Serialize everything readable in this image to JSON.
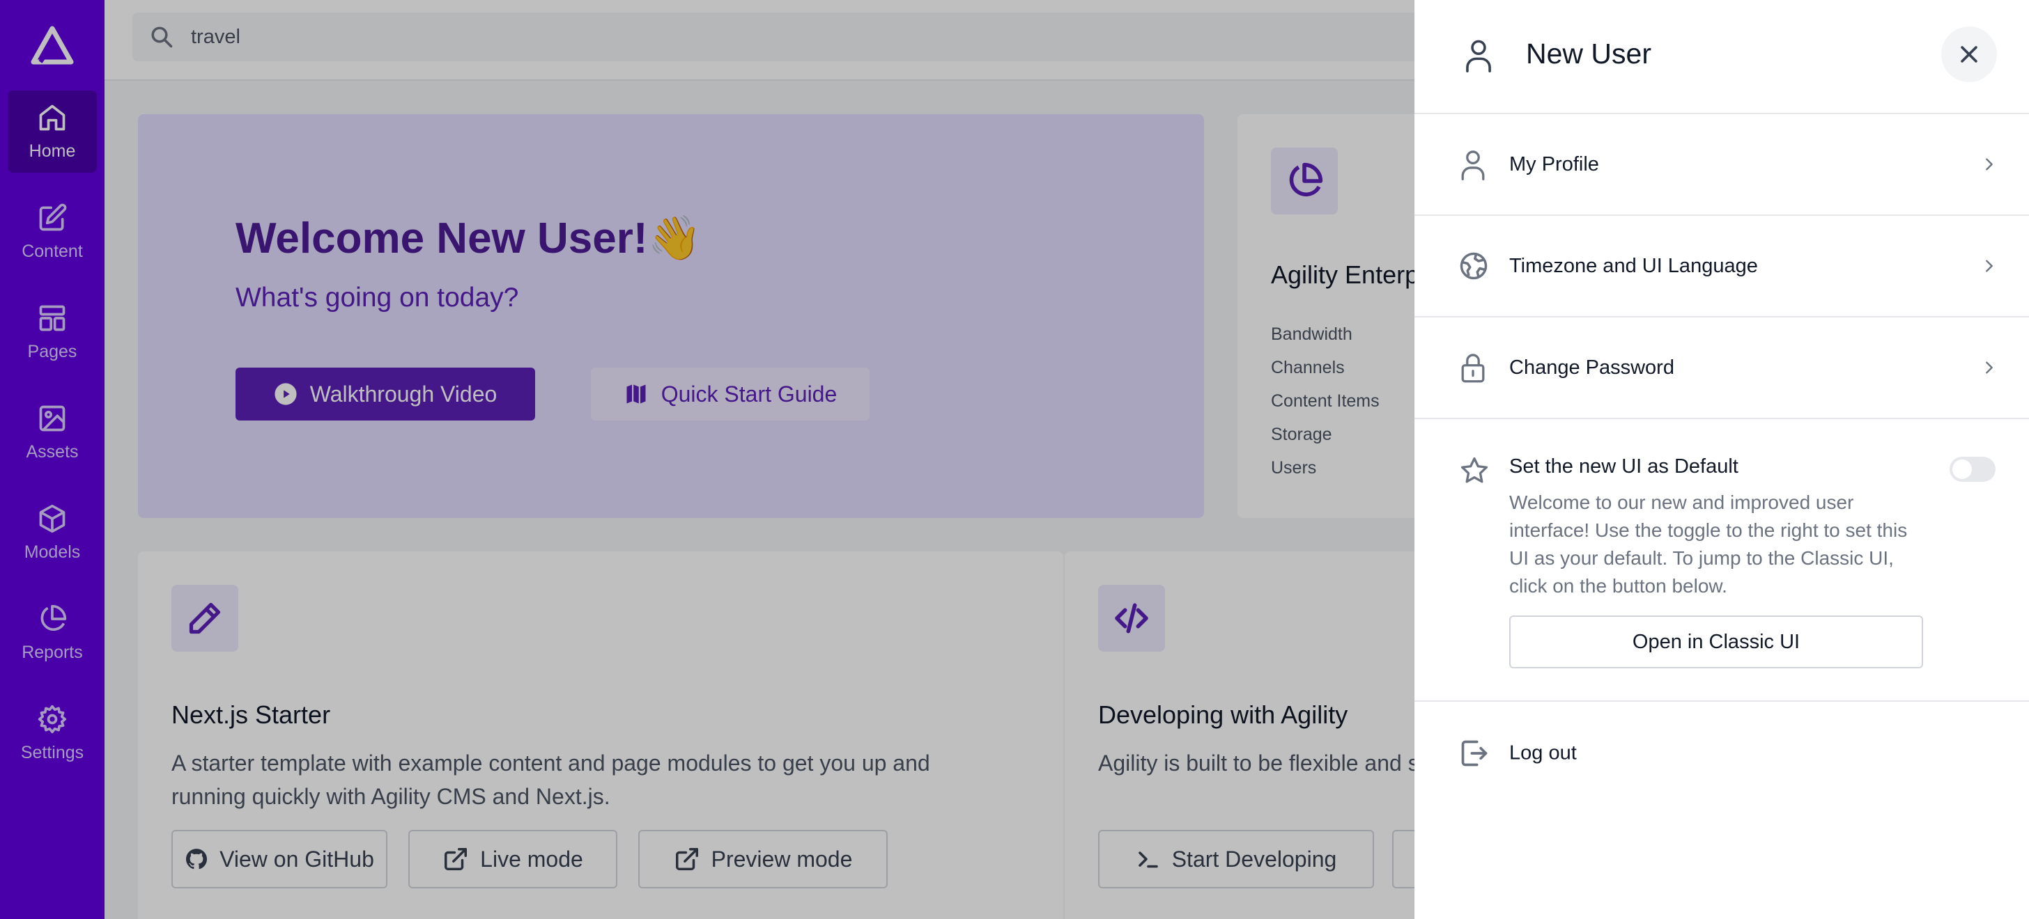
{
  "sidebar": {
    "items": [
      {
        "label": "Home",
        "icon": "home-icon"
      },
      {
        "label": "Content",
        "icon": "edit-icon"
      },
      {
        "label": "Pages",
        "icon": "layout-icon"
      },
      {
        "label": "Assets",
        "icon": "image-icon"
      },
      {
        "label": "Models",
        "icon": "cube-icon"
      },
      {
        "label": "Reports",
        "icon": "pie-chart-icon"
      },
      {
        "label": "Settings",
        "icon": "gear-icon"
      }
    ],
    "active": "Home"
  },
  "search": {
    "value": "travel"
  },
  "hero": {
    "title": "Welcome New User!",
    "emoji": "👋",
    "subtitle": "What's going on today?",
    "primary_button": "Walkthrough Video",
    "secondary_button": "Quick Start Guide"
  },
  "stats": {
    "title": "Agility Enterprise",
    "items": [
      "Bandwidth",
      "Channels",
      "Content Items",
      "Storage",
      "Users"
    ]
  },
  "cards": [
    {
      "title": "Next.js Starter",
      "description": "A starter template with example content and page modules to get you up and running quickly with Agility CMS and Next.js.",
      "buttons": [
        "View on GitHub",
        "Live mode",
        "Preview mode"
      ]
    },
    {
      "title": "Developing with Agility",
      "description": "Agility is built to be flexible and scale to your needs.",
      "buttons": [
        "Start Developing"
      ]
    }
  ],
  "drawer": {
    "title": "New User",
    "menu": [
      {
        "label": "My Profile",
        "icon": "user-icon"
      },
      {
        "label": "Timezone and UI Language",
        "icon": "globe-icon"
      },
      {
        "label": "Change Password",
        "icon": "lock-icon"
      }
    ],
    "default_ui": {
      "title": "Set the new UI as Default",
      "description": "Welcome to our new and improved user interface! Use the toggle to the right to set this UI as your default. To jump to the Classic UI, click on the button below.",
      "toggle_on": false,
      "button": "Open in Classic UI"
    },
    "logout": "Log out"
  },
  "colors": {
    "brand": "#6200e0",
    "brand_dark": "#4a00ad",
    "accent": "#5b21b6"
  }
}
